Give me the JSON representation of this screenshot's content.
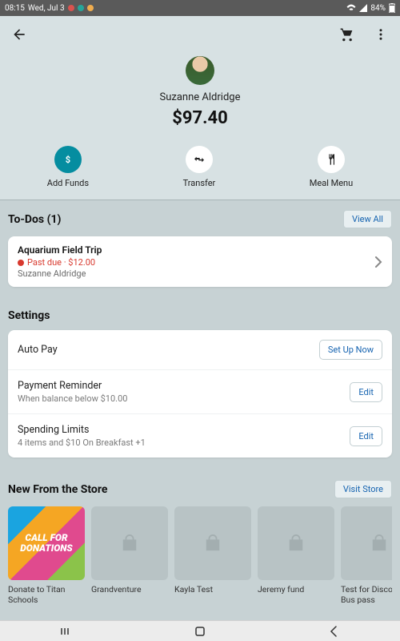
{
  "statusbar": {
    "time": "08:15",
    "date": "Wed, Jul 3",
    "battery": "84%"
  },
  "profile": {
    "name": "Suzanne Aldridge",
    "balance": "$97.40"
  },
  "actions": {
    "add_funds": "Add Funds",
    "transfer": "Transfer",
    "meal_menu": "Meal Menu"
  },
  "todos": {
    "header": "To-Dos (1)",
    "view_all": "View All",
    "item": {
      "title": "Aquarium Field Trip",
      "status": "Past due · $12.00",
      "person": "Suzanne Aldridge"
    }
  },
  "settings": {
    "header": "Settings",
    "rows": [
      {
        "title": "Auto Pay",
        "desc": "",
        "action": "Set Up Now"
      },
      {
        "title": "Payment Reminder",
        "desc": "When balance below $10.00",
        "action": "Edit"
      },
      {
        "title": "Spending Limits",
        "desc": "4 items and $10 On Breakfast +1",
        "action": "Edit"
      }
    ]
  },
  "store": {
    "header": "New From the Store",
    "visit": "Visit Store",
    "items": [
      {
        "label": "Donate to Titan Schools",
        "tile_text": "CALL FOR DONATIONS"
      },
      {
        "label": "Grandventure"
      },
      {
        "label": "Kayla Test"
      },
      {
        "label": "Jeremy fund"
      },
      {
        "label": "Test for Discount Bus pass"
      }
    ]
  }
}
